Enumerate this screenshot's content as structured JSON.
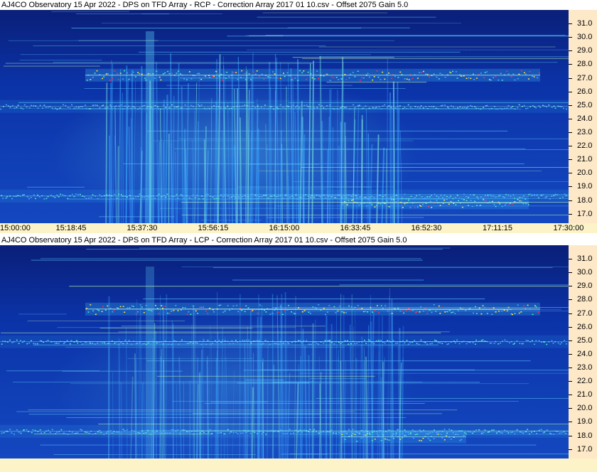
{
  "chart_data": [
    {
      "type": "heatmap",
      "title": "AJ4CO Observatory 15 Apr 2022  -  DPS on TFD Array  -  RCP  -  Correction Array 2017 01 10.csv  -  Offset 2075  Gain 5.0",
      "polarization": "RCP",
      "y_ticks": [
        "31.0",
        "30.0",
        "29.0",
        "28.0",
        "27.0",
        "26.0",
        "25.0",
        "24.0",
        "23.0",
        "22.0",
        "21.0",
        "20.0",
        "19.0",
        "18.0",
        "17.0"
      ],
      "ylim": [
        16.3,
        32.0
      ],
      "x_ticks": [
        "15:00:00",
        "15:18:45",
        "15:37:30",
        "15:56:15",
        "16:15:00",
        "16:33:45",
        "16:52:30",
        "17:11:15",
        "17:30:00"
      ],
      "colors": {
        "background": "#0a2c9c",
        "mid": "#1f7be0",
        "high": "#4fe0d0",
        "peak": "#ffe040",
        "hot": "#ff3050"
      },
      "bright_bands": [
        {
          "freq": 27.2,
          "start": 0.15,
          "end": 0.95,
          "level": 1.0
        },
        {
          "freq": 17.8,
          "start": 0.6,
          "end": 0.93,
          "level": 0.85
        },
        {
          "freq": 18.3,
          "start": 0.0,
          "end": 1.0,
          "level": 0.5
        },
        {
          "freq": 24.9,
          "start": 0.0,
          "end": 1.0,
          "level": 0.45
        }
      ]
    },
    {
      "type": "heatmap",
      "title": "AJ4CO Observatory 15 Apr 2022  -  DPS on TFD Array  -  LCP  -  Correction Array 2017 01 10.csv  -  Offset 2075  Gain 5.0",
      "polarization": "LCP",
      "y_ticks": [
        "31.0",
        "30.0",
        "29.0",
        "28.0",
        "27.0",
        "26.0",
        "25.0",
        "24.0",
        "23.0",
        "22.0",
        "21.0",
        "20.0",
        "19.0",
        "18.0",
        "17.0"
      ],
      "ylim": [
        16.3,
        32.0
      ],
      "x_ticks": [],
      "colors": {
        "background": "#0a2c9c",
        "mid": "#1f7be0",
        "high": "#4fe0d0",
        "peak": "#ffe040",
        "hot": "#ff3050"
      },
      "bright_bands": [
        {
          "freq": 27.3,
          "start": 0.15,
          "end": 0.95,
          "level": 1.0
        },
        {
          "freq": 17.9,
          "start": 0.6,
          "end": 0.82,
          "level": 0.8
        },
        {
          "freq": 18.3,
          "start": 0.0,
          "end": 1.0,
          "level": 0.5
        },
        {
          "freq": 24.9,
          "start": 0.0,
          "end": 1.0,
          "level": 0.45
        }
      ]
    }
  ]
}
